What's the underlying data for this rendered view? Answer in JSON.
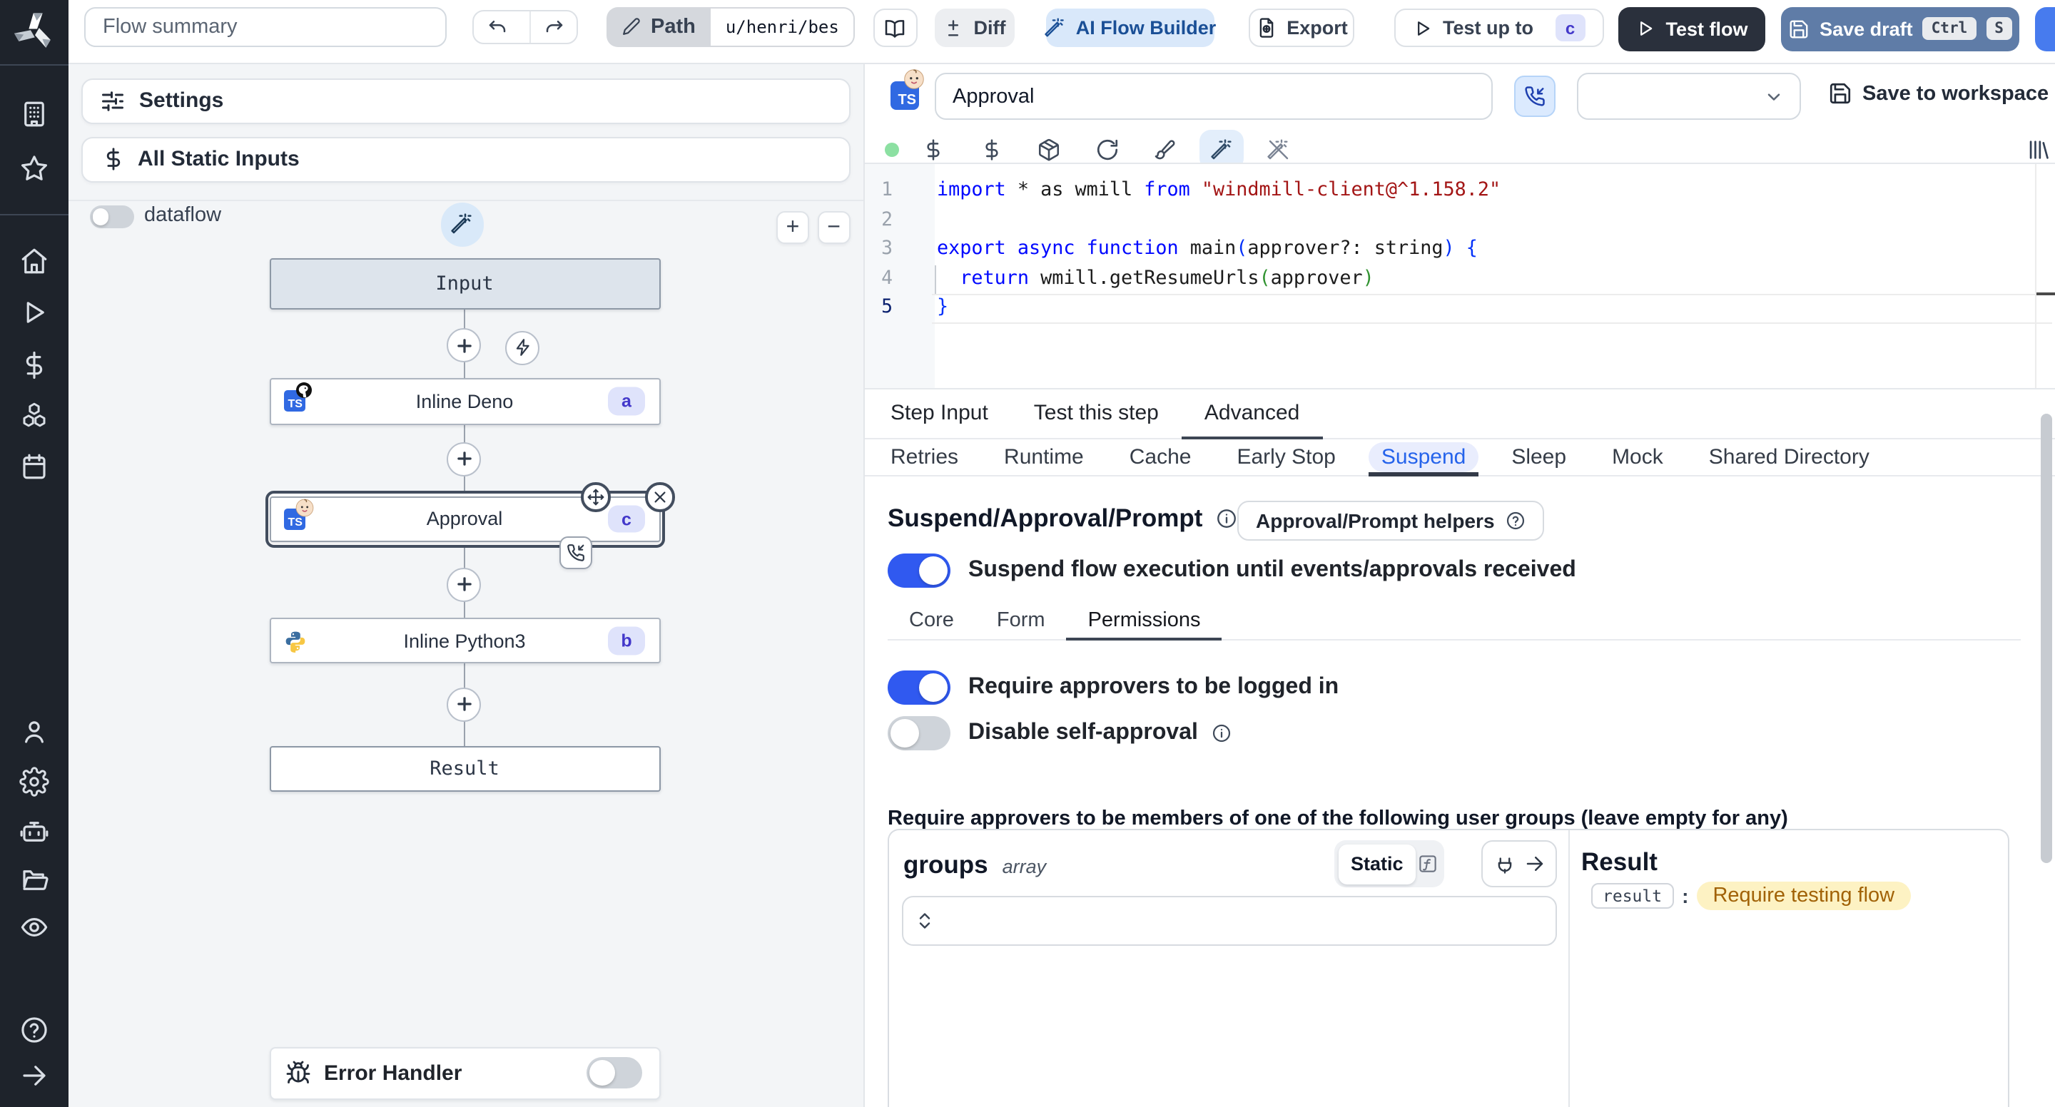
{
  "colors": {
    "accent_blue": "#3059f0",
    "sidebar_bg": "#1e232b",
    "badge_bg": "#dfe3fb",
    "badge_text": "#4338ca",
    "keyword": "#0008ff",
    "string": "#a31515",
    "result_highlight_bg": "#fdf2c3"
  },
  "topbar": {
    "flow_summary_placeholder": "Flow summary",
    "path_label": "Path",
    "path_value": "u/henri/bes",
    "diff_label": "Diff",
    "ai_flow_builder_label": "AI Flow Builder",
    "export_label": "Export",
    "test_up_to_label": "Test up to",
    "test_up_to_badge": "c",
    "test_flow_label": "Test flow",
    "save_draft_label": "Save draft",
    "save_draft_kbd_1": "Ctrl",
    "save_draft_kbd_2": "S"
  },
  "left_panel": {
    "settings_label": "Settings",
    "static_inputs_label": "All Static Inputs",
    "dataflow_label": "dataflow",
    "zoom_in_label": "+",
    "zoom_out_label": "−",
    "error_handler_label": "Error Handler",
    "nodes": {
      "input": {
        "label": "Input"
      },
      "deno": {
        "label": "Inline Deno",
        "badge": "a",
        "lang": "typescript-deno"
      },
      "approval": {
        "label": "Approval",
        "badge": "c",
        "lang": "typescript-approval",
        "selected": true
      },
      "python": {
        "label": "Inline Python3",
        "badge": "b",
        "lang": "python3"
      },
      "result": {
        "label": "Result"
      }
    }
  },
  "step_editor": {
    "step_name_value": "Approval",
    "language_icon": "TS",
    "select_value": "",
    "save_to_workspace_label": "Save to workspace",
    "status_dot": "saved-green",
    "code": {
      "lines": [
        {
          "num": "1",
          "segments": [
            {
              "c": "k",
              "t": "import"
            },
            {
              "c": "p",
              "t": " * as wmill "
            },
            {
              "c": "k",
              "t": "from"
            },
            {
              "c": "p",
              "t": " "
            },
            {
              "c": "s",
              "t": "\"windmill-client@^1.158.2\""
            }
          ]
        },
        {
          "num": "2",
          "segments": []
        },
        {
          "num": "3",
          "segments": [
            {
              "c": "k",
              "t": "export"
            },
            {
              "c": "p",
              "t": " "
            },
            {
              "c": "k",
              "t": "async"
            },
            {
              "c": "p",
              "t": " "
            },
            {
              "c": "k",
              "t": "function"
            },
            {
              "c": "p",
              "t": " main"
            },
            {
              "c": "b1",
              "t": "("
            },
            {
              "c": "p",
              "t": "approver?: string"
            },
            {
              "c": "b1",
              "t": ")"
            },
            {
              "c": "p",
              "t": " "
            },
            {
              "c": "b1",
              "t": "{"
            }
          ]
        },
        {
          "num": "4",
          "segments": [
            {
              "c": "p",
              "t": "  "
            },
            {
              "c": "k",
              "t": "return"
            },
            {
              "c": "p",
              "t": " wmill.getResumeUrls"
            },
            {
              "c": "b2",
              "t": "("
            },
            {
              "c": "p",
              "t": "approver"
            },
            {
              "c": "b2",
              "t": ")"
            }
          ]
        },
        {
          "num": "5",
          "segments": [
            {
              "c": "b1",
              "t": "}"
            }
          ],
          "active": true
        }
      ]
    }
  },
  "tabs": {
    "main": [
      {
        "label": "Step Input",
        "active": false
      },
      {
        "label": "Test this step",
        "active": false
      },
      {
        "label": "Advanced",
        "active": true
      }
    ],
    "advanced": [
      {
        "label": "Retries",
        "active": false
      },
      {
        "label": "Runtime",
        "active": false
      },
      {
        "label": "Cache",
        "active": false
      },
      {
        "label": "Early Stop",
        "active": false
      },
      {
        "label": "Suspend",
        "active": true
      },
      {
        "label": "Sleep",
        "active": false
      },
      {
        "label": "Mock",
        "active": false
      },
      {
        "label": "Shared Directory",
        "active": false
      }
    ],
    "suspend": [
      {
        "label": "Core",
        "active": false
      },
      {
        "label": "Form",
        "active": false
      },
      {
        "label": "Permissions",
        "active": true
      }
    ]
  },
  "suspend_section": {
    "title": "Suspend/Approval/Prompt",
    "helpers_button_label": "Approval/Prompt helpers",
    "suspend_toggle_label": "Suspend flow execution until events/approvals received",
    "suspend_toggle_on": true,
    "require_logged_in_label": "Require approvers to be logged in",
    "require_logged_in_on": true,
    "disable_self_approval_label": "Disable self-approval",
    "disable_self_approval_on": false,
    "members_heading": "Require approvers to be members of one of the following user groups (leave empty for any)",
    "groups": {
      "name": "groups",
      "type": "array",
      "mode_static_label": "Static",
      "input_value": ""
    },
    "result": {
      "title": "Result",
      "key": "result",
      "colon": ":",
      "value": "Require testing flow"
    }
  }
}
